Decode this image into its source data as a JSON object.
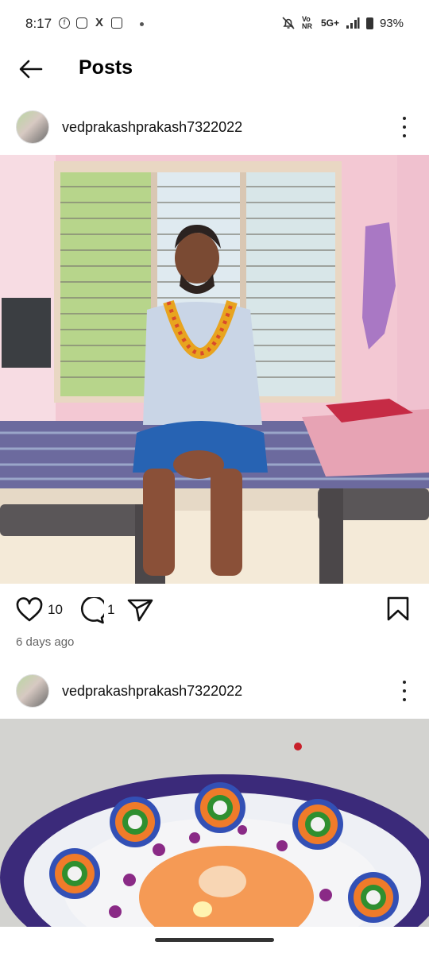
{
  "status_bar": {
    "time": "8:17",
    "network": "5G+",
    "volte": "Vo NR",
    "battery": "93%"
  },
  "header": {
    "title": "Posts"
  },
  "posts": [
    {
      "username": "vedprakashprakash7322022",
      "likes": "10",
      "comments": "1",
      "time_ago": "6 days ago"
    },
    {
      "username": "vedprakashprakash7322022"
    }
  ],
  "colors": {
    "accent": "#000000",
    "secondary_text": "#666666"
  }
}
